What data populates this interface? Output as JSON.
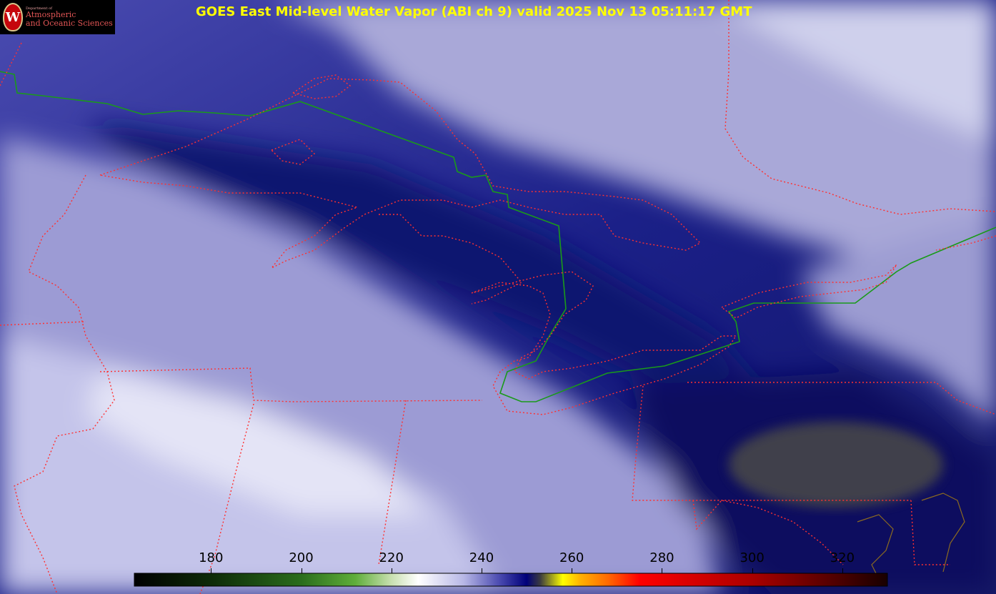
{
  "logo": {
    "department": "Department of",
    "line1": "Atmospheric",
    "line2": "and Oceanic Sciences",
    "crest_letter": "W"
  },
  "title": "GOES East Mid-level Water Vapor (ABI ch 9)  valid 2025 Nov 13 05:11:17 GMT",
  "colorbar": {
    "min": 163,
    "max": 330,
    "ticks": [
      180,
      200,
      220,
      240,
      260,
      280,
      300,
      320
    ],
    "stops": [
      {
        "v": 163,
        "c": "#000000"
      },
      {
        "v": 180,
        "c": "#0d2a08"
      },
      {
        "v": 200,
        "c": "#2a6d1c"
      },
      {
        "v": 212,
        "c": "#5fae3a"
      },
      {
        "v": 220,
        "c": "#c8e0b0"
      },
      {
        "v": 226,
        "c": "#ffffff"
      },
      {
        "v": 236,
        "c": "#b8b8e6"
      },
      {
        "v": 244,
        "c": "#4a4ab0"
      },
      {
        "v": 250,
        "c": "#00007a"
      },
      {
        "v": 253,
        "c": "#3a3a40"
      },
      {
        "v": 258,
        "c": "#ffff00"
      },
      {
        "v": 262,
        "c": "#ffb000"
      },
      {
        "v": 268,
        "c": "#ff6a00"
      },
      {
        "v": 275,
        "c": "#ff0000"
      },
      {
        "v": 300,
        "c": "#aa0000"
      },
      {
        "v": 330,
        "c": "#180000"
      }
    ]
  },
  "colors": {
    "state_borders": "#ff3030",
    "international_border": "#1a9a1a",
    "coastline": "#8b6a20",
    "title": "#ffff00"
  }
}
